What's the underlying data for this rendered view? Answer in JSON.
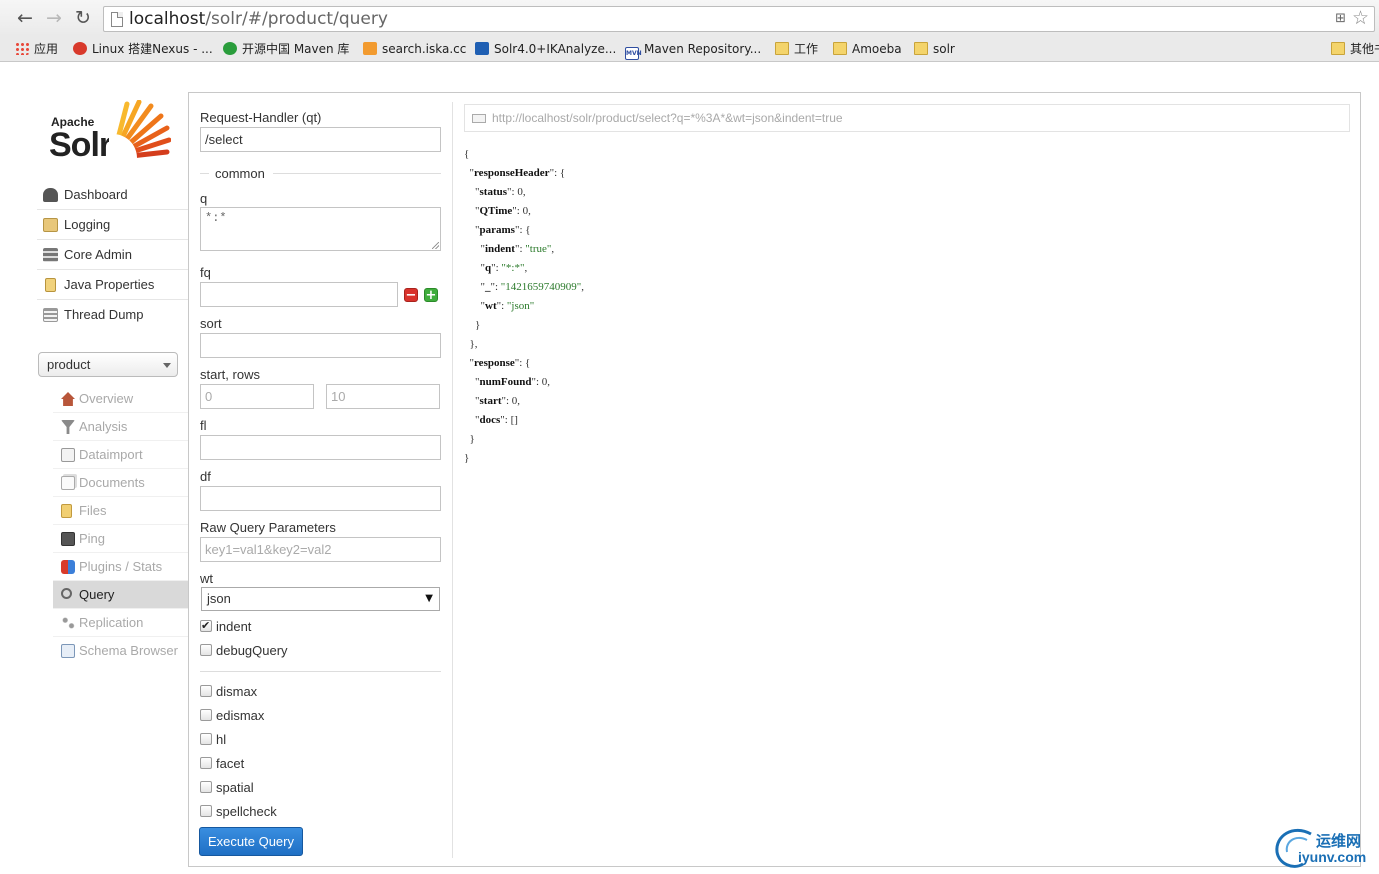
{
  "browser": {
    "url_host": "localhost",
    "url_path": "/solr/#/product/query",
    "bookmarks": [
      {
        "label": "应用",
        "icon": "apps-icon"
      },
      {
        "label": "Linux 搭建Nexus - ...",
        "icon": "baidu-icon"
      },
      {
        "label": "开源中国 Maven 库",
        "icon": "oschina-icon"
      },
      {
        "label": "search.iska.cc",
        "icon": "solr-icon"
      },
      {
        "label": "Solr4.0+IKAnalyze...",
        "icon": "blog-icon"
      },
      {
        "label": "Maven Repository...",
        "icon": "mvn-icon"
      },
      {
        "label": "工作",
        "icon": "folder-icon"
      },
      {
        "label": "Amoeba",
        "icon": "folder-icon"
      },
      {
        "label": "solr",
        "icon": "folder-icon"
      },
      {
        "label": "其他书",
        "icon": "folder-icon"
      }
    ]
  },
  "logo": {
    "apache": "Apache",
    "solr": "Solr"
  },
  "sidebar": {
    "items": [
      {
        "label": "Dashboard",
        "icon": "dashboard-icon"
      },
      {
        "label": "Logging",
        "icon": "logging-icon"
      },
      {
        "label": "Core Admin",
        "icon": "core-admin-icon"
      },
      {
        "label": "Java Properties",
        "icon": "java-icon"
      },
      {
        "label": "Thread Dump",
        "icon": "thread-dump-icon"
      }
    ],
    "core_selected": "product",
    "core_menu": [
      {
        "label": "Overview",
        "icon": "home-icon"
      },
      {
        "label": "Analysis",
        "icon": "filter-icon"
      },
      {
        "label": "Dataimport",
        "icon": "dataimport-icon"
      },
      {
        "label": "Documents",
        "icon": "documents-icon"
      },
      {
        "label": "Files",
        "icon": "files-icon"
      },
      {
        "label": "Ping",
        "icon": "ping-icon"
      },
      {
        "label": "Plugins / Stats",
        "icon": "plugins-icon"
      },
      {
        "label": "Query",
        "icon": "search-icon"
      },
      {
        "label": "Replication",
        "icon": "replication-icon"
      },
      {
        "label": "Schema Browser",
        "icon": "schema-icon"
      }
    ]
  },
  "form": {
    "qt_label": "Request-Handler (qt)",
    "qt_value": "/select",
    "common_label": "common",
    "q_label": "q",
    "q_value": "*:*",
    "fq_label": "fq",
    "fq_value": "",
    "sort_label": "sort",
    "sort_value": "",
    "start_rows_label": "start, rows",
    "start_placeholder": "0",
    "rows_placeholder": "10",
    "fl_label": "fl",
    "df_label": "df",
    "raw_label": "Raw Query Parameters",
    "raw_placeholder": "key1=val1&key2=val2",
    "wt_label": "wt",
    "wt_value": "json",
    "indent_label": "indent",
    "debug_label": "debugQuery",
    "dismax_label": "dismax",
    "edismax_label": "edismax",
    "hl_label": "hl",
    "facet_label": "facet",
    "spatial_label": "spatial",
    "spellcheck_label": "spellcheck",
    "execute_label": "Execute Query"
  },
  "response": {
    "url": "http://localhost/solr/product/select?q=*%3A*&wt=json&indent=true",
    "status": "0",
    "qtime": "0",
    "indent": "true",
    "q": "*:*",
    "underscore": "1421659740909",
    "wt": "json",
    "numFound": "0",
    "start": "0",
    "docs": "[]"
  },
  "watermark": {
    "cn": "运维网",
    "en": "iyunv.com"
  }
}
